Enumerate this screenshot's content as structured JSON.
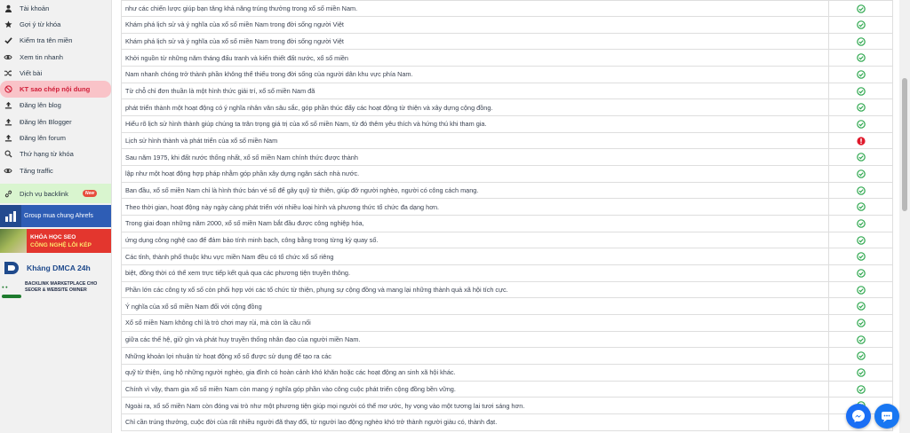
{
  "sidebar": {
    "items": [
      {
        "label": "Tài khoản",
        "icon": "user-icon"
      },
      {
        "label": "Gợi ý từ khóa",
        "icon": "star-icon"
      },
      {
        "label": "Kiểm tra tên miền",
        "icon": "check-icon"
      },
      {
        "label": "Xem tin nhanh",
        "icon": "eye-icon"
      },
      {
        "label": "Viết bài",
        "icon": "shuffle-icon"
      },
      {
        "label": "KT sao chép nội dung",
        "icon": "ban-icon"
      },
      {
        "label": "Đăng lên blog",
        "icon": "upload-icon"
      },
      {
        "label": "Đăng lên Blogger",
        "icon": "upload-icon"
      },
      {
        "label": "Đăng lên forum",
        "icon": "upload-icon"
      },
      {
        "label": "Thứ hạng từ khóa",
        "icon": "search-icon"
      },
      {
        "label": "Tăng traffic",
        "icon": "eye-icon"
      }
    ],
    "backlink": {
      "label": "Dịch vụ backlink",
      "badge": "New"
    },
    "banners": {
      "ahrefs": "Group mua chung Ahrefs",
      "seo_line1": "KHÓA HỌC SEO",
      "seo_line2": "CÔNG NGHỆ LỖI KÉP",
      "dmca": "Kháng DMCA 24h",
      "market_line1": "BACKLINK MARKETPLACE CHO",
      "market_line2": "SEOER & WEBSITE OWNER"
    }
  },
  "rows": [
    {
      "text": "như các chiến lược giúp bạn tăng khả năng trúng thưởng trong xổ số miền Nam.",
      "status": "ok"
    },
    {
      "text": "Khám phá lịch sử và ý nghĩa của xổ số miền Nam trong đời sống người Việt",
      "status": "ok"
    },
    {
      "text": "Khám phá lịch sử và ý nghĩa của xổ số miền Nam trong đời sống người Việt",
      "status": "ok"
    },
    {
      "text": "Khởi nguồn từ những năm tháng đấu tranh và kiến thiết đất nước, xổ số miền",
      "status": "ok"
    },
    {
      "text": "Nam nhanh chóng trở thành phần không thể thiếu trong đời sống của người dân khu vực phía Nam.",
      "status": "ok"
    },
    {
      "text": "Từ chỗ chỉ đơn thuần là một hình thức giải trí, xổ số miền Nam đã",
      "status": "ok"
    },
    {
      "text": "phát triển thành một hoạt động có ý nghĩa nhân văn sâu sắc, góp phần thúc đẩy các hoạt động từ thiện và xây dựng cộng đồng.",
      "status": "ok"
    },
    {
      "text": "Hiểu rõ lịch sử hình thành giúp chúng ta trân trọng giá trị của xổ số miền Nam, từ đó thêm yêu thích và hứng thú khi tham gia.",
      "status": "ok"
    },
    {
      "text": "Lịch sử hình thành và phát triển của xổ số miền Nam",
      "status": "error"
    },
    {
      "text": "Sau năm 1975, khi đất nước thống nhất, xổ số miền Nam chính thức được thành",
      "status": "ok"
    },
    {
      "text": "lập như một hoạt động hợp pháp nhằm góp phần xây dựng ngân sách nhà nước.",
      "status": "ok"
    },
    {
      "text": "Ban đầu, xổ số miền Nam chỉ là hình thức bán vé số để gây quỹ từ thiện, giúp đỡ người nghèo, người có công cách mạng.",
      "status": "ok"
    },
    {
      "text": "Theo thời gian, hoạt động này ngày càng phát triển với nhiều loại hình và phương thức tổ chức đa dạng hơn.",
      "status": "ok"
    },
    {
      "text": "Trong giai đoạn những năm 2000, xổ số miền Nam bắt đầu được công nghiệp hóa,",
      "status": "ok"
    },
    {
      "text": "ứng dụng công nghệ cao để đảm bảo tính minh bạch, công bằng trong từng kỳ quay số.",
      "status": "ok"
    },
    {
      "text": "Các tỉnh, thành phố thuộc khu vực miền Nam đều có tổ chức xổ số riêng",
      "status": "ok"
    },
    {
      "text": "biệt, đồng thời có thể xem trực tiếp kết quả qua các phương tiện truyền thông.",
      "status": "ok"
    },
    {
      "text": "Phần lớn các công ty xổ số còn phối hợp với các tổ chức từ thiện, phụng sự cộng đồng và mang lại những thành quả xã hội tích cực.",
      "status": "ok"
    },
    {
      "text": "Ý nghĩa của xổ số miền Nam đối với cộng đồng",
      "status": "ok"
    },
    {
      "text": "Xổ số miền Nam không chỉ là trò chơi may rủi, mà còn là cầu nối",
      "status": "ok"
    },
    {
      "text": "giữa các thế hệ, giữ gìn và phát huy truyền thống nhân đạo của người miền Nam.",
      "status": "ok"
    },
    {
      "text": "Những khoản lợi nhuận từ hoạt động xổ số được sử dụng để tạo ra các",
      "status": "ok"
    },
    {
      "text": "quỹ từ thiện, ủng hộ những người nghèo, gia đình có hoàn cảnh khó khăn hoặc các hoạt động an sinh xã hội khác.",
      "status": "ok"
    },
    {
      "text": "Chính vì vậy, tham gia xổ số miền Nam còn mang ý nghĩa góp phần vào công cuộc phát triển cộng đồng bền vững.",
      "status": "ok"
    },
    {
      "text": "Ngoài ra, xổ số miền Nam còn đóng vai trò như một phương tiện giúp mọi người có thể mơ ước, hy vọng vào một tương lai tươi sáng hơn.",
      "status": "ok"
    },
    {
      "text": "Chỉ cần trúng thưởng, cuộc đời của rất nhiều người đã thay đổi, từ người lao động nghèo khó trở thành người giàu có, thành đạt.",
      "status": "ok"
    }
  ],
  "colors": {
    "ok": "#2fa84f",
    "error": "#e0192b",
    "active_bg": "#f9c3c8",
    "active_text": "#d0203a"
  }
}
